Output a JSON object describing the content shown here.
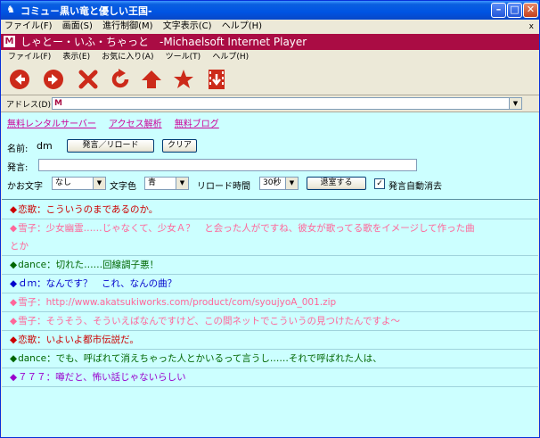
{
  "window": {
    "title": "コミュ－黒い竜と優しい王国-",
    "menu": [
      "ファイル(F)",
      "画面(S)",
      "進行制御(M)",
      "文字表示(C)",
      "ヘルプ(H)"
    ],
    "close_glyph": "x"
  },
  "player": {
    "title": "しゃとー・いふ・ちゃっと　-Michaelsoft Internet Player",
    "menu": [
      "ファイル(F)",
      "表示(E)",
      "お気に入り(A)",
      "ツール(T)",
      "ヘルプ(H)"
    ]
  },
  "address": {
    "label": "アドレス(D)",
    "value": ""
  },
  "links": [
    "無料レンタルサーバー",
    "アクセス解析",
    "無料ブログ"
  ],
  "form": {
    "name_label": "名前:",
    "name_value": "dm",
    "post_button": "発言／リロード",
    "clear_button": "クリア",
    "message_label": "発言:",
    "message_value": "",
    "kaomoji_label": "かお文字",
    "kaomoji_value": "なし",
    "color_label": "文字色",
    "color_value": "青",
    "reload_label": "リロード時間",
    "reload_value": "30秒",
    "leave_button": "退室する",
    "autoclear_label": "発言自動消去",
    "autoclear_checked": "✓"
  },
  "messages": [
    {
      "speaker": "恋歌",
      "text": "こういうのまであるのか。",
      "color": "#cc0000"
    },
    {
      "speaker": "雪子",
      "text": "少女幽霊……じゃなくて、少女Ａ？　と会った人がですね、彼女が歌ってる歌をイメージして作った曲",
      "color": "#ff6699"
    },
    {
      "speaker": "",
      "text": "とか",
      "color": "#ff6699",
      "continuation": true
    },
    {
      "speaker": "dance",
      "text": "切れた……回線調子悪！",
      "color": "#006600"
    },
    {
      "speaker": "ｄｍ",
      "text": "なんです？　これ、なんの曲？",
      "color": "#0000cc"
    },
    {
      "speaker": "雪子",
      "text": "http://www.akatsukiworks.com/product/com/syoujyoA_001.zip",
      "color": "#ff6699"
    },
    {
      "speaker": "雪子",
      "text": "そうそう、そういえばなんですけど、この間ネットでこういうの見つけたんですよ～",
      "color": "#ff6699"
    },
    {
      "speaker": "恋歌",
      "text": "いよいよ都市伝説だ。",
      "color": "#cc0000"
    },
    {
      "speaker": "dance",
      "text": "でも、呼ばれて消えちゃった人とかいるって言うし……それで呼ばれた人は、",
      "color": "#006600"
    },
    {
      "speaker": "７７７",
      "text": "噂だと、怖い話じゃないらしい",
      "color": "#9900cc"
    }
  ],
  "colors": {
    "player_title_bg": "#aa0c44",
    "content_bg": "#ccffff",
    "link": "#cc0099",
    "toolbar_icon": "#cc2a1a"
  },
  "toolbar_icons": [
    "back-icon",
    "forward-icon",
    "stop-icon",
    "refresh-icon",
    "home-icon",
    "favorites-icon",
    "media-icon"
  ]
}
